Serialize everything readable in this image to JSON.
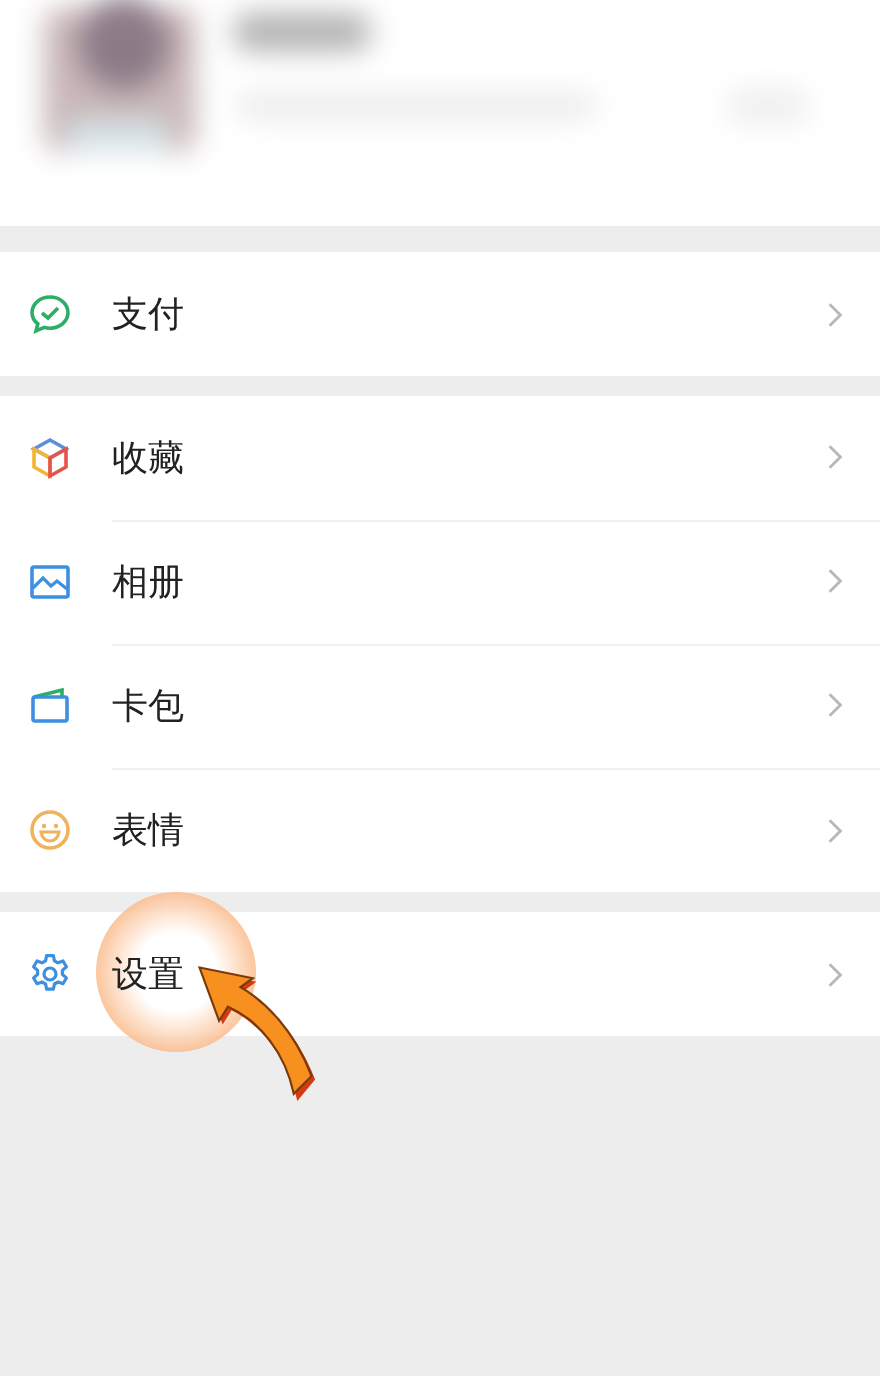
{
  "sections": [
    {
      "items": [
        {
          "label": "支付",
          "kind": "pay",
          "highlighted": false
        }
      ]
    },
    {
      "items": [
        {
          "label": "收藏",
          "kind": "favorites",
          "highlighted": false
        },
        {
          "label": "相册",
          "kind": "album",
          "highlighted": false
        },
        {
          "label": "卡包",
          "kind": "cards",
          "highlighted": false
        },
        {
          "label": "表情",
          "kind": "stickers",
          "highlighted": false
        }
      ]
    },
    {
      "items": [
        {
          "label": "设置",
          "kind": "settings",
          "highlighted": true
        }
      ]
    }
  ]
}
